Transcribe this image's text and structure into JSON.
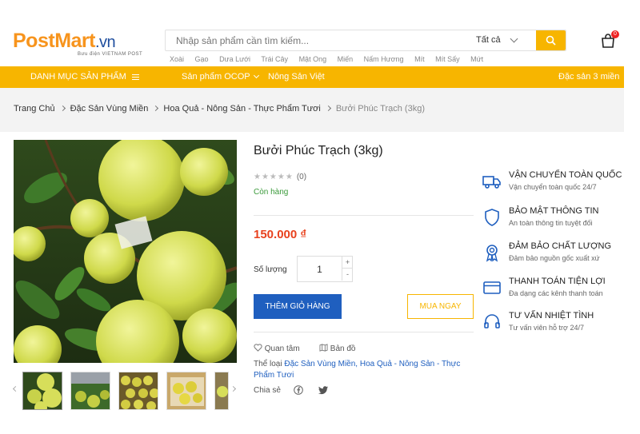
{
  "header": {
    "logo_post": "Post",
    "logo_mart": "Mart",
    "logo_vn": ".vn",
    "logo_sub": "Bưu điện VIETNAM POST",
    "search_placeholder": "Nhập sản phẩm cần tìm kiếm...",
    "search_scope": "Tất cả",
    "cart_count": "0",
    "tags": [
      "Xoài",
      "Gạo",
      "Dưa Lưới",
      "Trái Cây",
      "Mật Ong",
      "Miến",
      "Nấm Hương",
      "Mít",
      "Mít Sấy",
      "Mứt"
    ]
  },
  "nav": {
    "category_label": "DANH MỤC SẢN PHẨM",
    "items": [
      "Sản phẩm OCOP",
      "Nông Sản Việt"
    ],
    "right_item": "Đặc sản 3 miền"
  },
  "breadcrumb": [
    "Trang Chủ",
    "Đặc Sản Vùng Miền",
    "Hoa Quả - Nông Sản - Thực Phẩm Tươi",
    "Bưởi Phúc Trạch (3kg)"
  ],
  "product": {
    "title": "Bưởi Phúc Trạch (3kg)",
    "rating_stars": "★★★★★",
    "review_count": "(0)",
    "stock": "Còn hàng",
    "price": "150.000 ₫",
    "quantity_label": "Số lượng",
    "quantity_value": "1",
    "plus": "+",
    "minus": "-",
    "add_to_cart": "THÊM GIỎ HÀNG",
    "buy_now": "MUA NGAY",
    "wishlist": "Quan tâm",
    "map": "Bản đồ",
    "category_label": "Thể loại",
    "category_links": "Đặc Sản Vùng Miền, Hoa Quả - Nông Sản - Thực Phẩm Tươi",
    "share_label": "Chia sẻ"
  },
  "features": [
    {
      "icon": "truck-icon",
      "title": "VẬN CHUYỂN TOÀN QUỐC",
      "sub": "Vận chuyển toàn quốc 24/7"
    },
    {
      "icon": "shield-icon",
      "title": "BẢO MẬT THÔNG TIN",
      "sub": "An toàn thông tin tuyệt đối"
    },
    {
      "icon": "award-icon",
      "title": "ĐẢM BẢO CHẤT LƯỢNG",
      "sub": "Đảm bảo nguồn gốc xuất xứ"
    },
    {
      "icon": "credit-card-icon",
      "title": "THANH TOÁN TIỆN LỢI",
      "sub": "Đa dạng các kênh thanh toán"
    },
    {
      "icon": "headset-icon",
      "title": "TƯ VẤN NHIỆT TÌNH",
      "sub": "Tư vấn viên hỗ trợ 24/7"
    }
  ],
  "colors": {
    "accent": "#f7b500",
    "primary": "#1f5fbf",
    "price": "#e8411d",
    "stock": "#3a9a3a"
  }
}
